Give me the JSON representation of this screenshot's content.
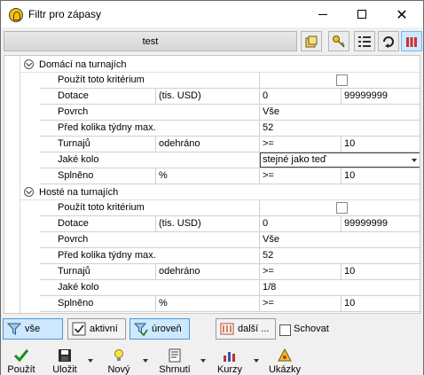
{
  "window": {
    "title": "Filtr pro zápasy"
  },
  "toolbar": {
    "name_label": "test"
  },
  "sections": [
    {
      "title": "Domácí na turnajích",
      "use_label": "Použít toto kritérium",
      "rows": {
        "dotace": {
          "label": "Dotace",
          "unit": "(tis. USD)",
          "from": "0",
          "to": "99999999"
        },
        "povrch": {
          "label": "Povrch",
          "value": "Vše"
        },
        "tydny": {
          "label": "Před kolika týdny max.",
          "value": "52"
        },
        "turnaju": {
          "label": "Turnajů",
          "unit": "odehráno",
          "op": ">=",
          "value": "10"
        },
        "kolo": {
          "label": "Jaké kolo",
          "value": "stejné jako teď"
        },
        "splneno": {
          "label": "Splněno",
          "unit": "%",
          "op": ">=",
          "value": "10"
        }
      }
    },
    {
      "title": "Hosté na turnajích",
      "use_label": "Použít toto kritérium",
      "rows": {
        "dotace": {
          "label": "Dotace",
          "unit": "(tis. USD)",
          "from": "0",
          "to": "99999999"
        },
        "povrch": {
          "label": "Povrch",
          "value": "Vše"
        },
        "tydny": {
          "label": "Před kolika týdny max.",
          "value": "52"
        },
        "turnaju": {
          "label": "Turnajů",
          "unit": "odehráno",
          "op": ">=",
          "value": "10"
        },
        "kolo": {
          "label": "Jaké kolo",
          "value": "1/8"
        },
        "splneno": {
          "label": "Splněno",
          "unit": "%",
          "op": ">=",
          "value": "10"
        }
      }
    }
  ],
  "filterbar": {
    "all_label": "vše",
    "active_label": "aktivní",
    "level_label": "úroveň",
    "more_label": "další ...",
    "hide_label": "Schovat"
  },
  "bottombar": {
    "use": "Použít",
    "save": "Uložit",
    "new": "Nový",
    "summary": "Shrnutí",
    "rates": "Kurzy",
    "examples": "Ukázky"
  },
  "colors": {
    "selected_bg": "#cde8ff",
    "selected_border": "#4c97d6"
  }
}
